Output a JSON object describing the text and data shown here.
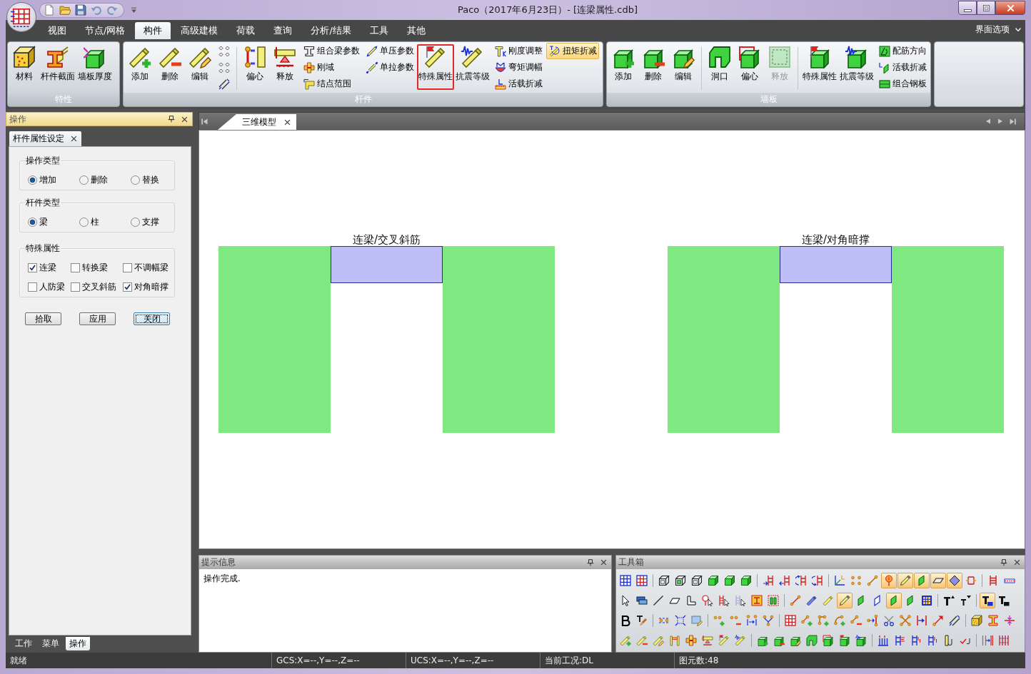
{
  "window": {
    "title": "Paco（2017年6月23日）- [连梁属性.cdb]"
  },
  "ribbon": {
    "tabs": [
      {
        "label": "视图",
        "selected": false
      },
      {
        "label": "节点/网格",
        "selected": false
      },
      {
        "label": "构件",
        "selected": true
      },
      {
        "label": "高级建模",
        "selected": false
      },
      {
        "label": "荷载",
        "selected": false
      },
      {
        "label": "查询",
        "selected": false
      },
      {
        "label": "分析/结果",
        "selected": false
      },
      {
        "label": "工具",
        "selected": false
      },
      {
        "label": "其他",
        "selected": false
      }
    ],
    "options_menu": "界面选项",
    "groups": [
      {
        "label": "特性",
        "items": [
          {
            "kind": "large",
            "label": "材料",
            "disabled": false,
            "highlighted": false
          },
          {
            "kind": "large",
            "label": "杆件截面",
            "disabled": false,
            "highlighted": false
          },
          {
            "kind": "large",
            "label": "墙板厚度",
            "disabled": false,
            "highlighted": false
          }
        ]
      },
      {
        "label": "杆件",
        "items": [
          {
            "kind": "large",
            "label": "添加",
            "disabled": false,
            "highlighted": false
          },
          {
            "kind": "large",
            "label": "删除",
            "disabled": false,
            "highlighted": false
          },
          {
            "kind": "large",
            "label": "编辑",
            "disabled": false,
            "highlighted": false
          },
          {
            "kind": "icons",
            "items": [
              {
                "on": false
              },
              {
                "on": false
              },
              {
                "on": false
              }
            ]
          },
          {
            "kind": "separator"
          },
          {
            "kind": "large",
            "label": "偏心",
            "disabled": false,
            "highlighted": false
          },
          {
            "kind": "large",
            "label": "释放",
            "disabled": false,
            "highlighted": false
          },
          {
            "kind": "stack",
            "items": [
              {
                "label": "组合梁参数",
                "on": false
              },
              {
                "label": "刚域",
                "on": false
              },
              {
                "label": "结点范围",
                "on": false
              }
            ]
          },
          {
            "kind": "stack",
            "items": [
              {
                "label": "单压参数",
                "on": false
              },
              {
                "label": "单拉参数",
                "on": false
              }
            ]
          },
          {
            "kind": "large",
            "label": "特殊属性",
            "disabled": false,
            "highlighted": true
          },
          {
            "kind": "large",
            "label": "抗震等级",
            "disabled": false,
            "highlighted": false
          },
          {
            "kind": "stack",
            "items": [
              {
                "label": "刚度调整",
                "on": false
              },
              {
                "label": "弯矩调幅",
                "on": false
              },
              {
                "label": "活载折减",
                "on": false
              }
            ]
          },
          {
            "kind": "stack",
            "items": [
              {
                "label": "扭矩折减",
                "on": true
              }
            ]
          }
        ]
      },
      {
        "label": "墙板",
        "items": [
          {
            "kind": "large",
            "label": "添加",
            "disabled": false,
            "highlighted": false
          },
          {
            "kind": "large",
            "label": "删除",
            "disabled": false,
            "highlighted": false
          },
          {
            "kind": "large",
            "label": "编辑",
            "disabled": false,
            "highlighted": false
          },
          {
            "kind": "separator"
          },
          {
            "kind": "large",
            "label": "洞口",
            "disabled": false,
            "highlighted": false
          },
          {
            "kind": "large",
            "label": "偏心",
            "disabled": false,
            "highlighted": false
          },
          {
            "kind": "large",
            "label": "释放",
            "disabled": true,
            "highlighted": false
          },
          {
            "kind": "separator"
          },
          {
            "kind": "large",
            "label": "特殊属性",
            "disabled": false,
            "highlighted": false
          },
          {
            "kind": "large",
            "label": "抗震等级",
            "disabled": false,
            "highlighted": false
          },
          {
            "kind": "stack",
            "items": [
              {
                "label": "配筋方向",
                "on": false
              },
              {
                "label": "活载折减",
                "on": false
              },
              {
                "label": "组合钢板",
                "on": false
              }
            ]
          }
        ]
      }
    ]
  },
  "operation_panel": {
    "title": "操作",
    "tabs": [
      {
        "label": "杆件属性设定",
        "selected": true
      }
    ],
    "sections": [
      {
        "title": "操作类型",
        "kind": "radio",
        "options": [
          {
            "label": "增加",
            "selected": true
          },
          {
            "label": "删除",
            "selected": false
          },
          {
            "label": "替换",
            "selected": false
          }
        ]
      },
      {
        "title": "杆件类型",
        "kind": "radio",
        "options": [
          {
            "label": "梁",
            "selected": true
          },
          {
            "label": "柱",
            "selected": false
          },
          {
            "label": "支撑",
            "selected": false
          }
        ]
      },
      {
        "title": "特殊属性",
        "kind": "checkbox",
        "options": [
          {
            "label": "连梁",
            "checked": true
          },
          {
            "label": "转换梁",
            "checked": false
          },
          {
            "label": "不调幅梁",
            "checked": false
          },
          {
            "label": "人防梁",
            "checked": false
          },
          {
            "label": "交叉斜筋",
            "checked": false
          },
          {
            "label": "对角暗撑",
            "checked": true
          }
        ]
      }
    ],
    "buttons": [
      {
        "label": "拾取",
        "focused": false
      },
      {
        "label": "应用",
        "focused": false
      },
      {
        "label": "关闭",
        "focused": true
      }
    ],
    "bottom_tabs": [
      {
        "label": "工作",
        "selected": false
      },
      {
        "label": "菜单",
        "selected": false
      },
      {
        "label": "操作",
        "selected": true
      }
    ]
  },
  "document": {
    "tabs": [
      {
        "label": "三维模型",
        "selected": true
      }
    ],
    "frames": [
      {
        "label": "连梁/交叉斜筋"
      },
      {
        "label": "连梁/对角暗撑"
      }
    ]
  },
  "hint_panel": {
    "title": "提示信息",
    "message": "操作完成."
  },
  "toolbox": {
    "title": "工具箱",
    "rows": [
      [
        [
          {
            "on": false
          },
          {
            "on": false
          }
        ],
        [
          {
            "on": false
          },
          {
            "on": false
          },
          {
            "on": false
          },
          {
            "on": false
          },
          {
            "on": false
          },
          {
            "on": false
          }
        ],
        [
          {
            "on": false
          },
          {
            "on": false
          },
          {
            "on": false
          },
          {
            "on": false
          }
        ],
        [
          {
            "on": false
          },
          {
            "on": false
          },
          {
            "on": false
          },
          {
            "on": true
          },
          {
            "on": true
          },
          {
            "on": true
          },
          {
            "on": true
          },
          {
            "on": true
          },
          {
            "on": false
          }
        ],
        [
          {
            "on": false
          },
          {
            "on": false
          }
        ]
      ],
      [
        [
          {
            "on": false
          },
          {
            "on": false
          },
          {
            "on": false
          },
          {
            "on": false
          },
          {
            "on": false
          },
          {
            "on": false
          },
          {
            "on": false
          },
          {
            "on": false
          },
          {
            "on": false
          },
          {
            "on": false
          }
        ],
        [
          {
            "on": false
          },
          {
            "on": false
          },
          {
            "on": false
          },
          {
            "on": true
          },
          {
            "on": false
          },
          {
            "on": false
          },
          {
            "on": true
          },
          {
            "on": false
          },
          {
            "on": false
          }
        ],
        [
          {
            "on": false
          },
          {
            "on": false
          }
        ],
        [
          {
            "on": true
          },
          {
            "on": false
          }
        ]
      ],
      [
        [
          {
            "on": false
          },
          {
            "on": false
          }
        ],
        [
          {
            "on": false
          },
          {
            "on": false
          },
          {
            "on": false
          }
        ],
        [
          {
            "on": false
          },
          {
            "on": false
          },
          {
            "on": false
          },
          {
            "on": false
          }
        ],
        [
          {
            "on": false
          },
          {
            "on": false
          },
          {
            "on": false
          },
          {
            "on": false
          },
          {
            "on": false
          },
          {
            "on": false
          },
          {
            "on": false
          },
          {
            "on": false
          },
          {
            "on": false
          },
          {
            "on": false
          },
          {
            "on": false
          }
        ],
        [
          {
            "on": false
          },
          {
            "on": false
          },
          {
            "on": false
          }
        ]
      ],
      [
        [
          {
            "on": false
          },
          {
            "on": false
          },
          {
            "on": false
          },
          {
            "on": false
          },
          {
            "on": false
          },
          {
            "on": false
          },
          {
            "on": false
          },
          {
            "on": false
          }
        ],
        [
          {
            "on": false
          },
          {
            "on": false
          },
          {
            "on": false
          },
          {
            "on": false
          },
          {
            "on": false
          },
          {
            "on": false
          },
          {
            "on": false
          }
        ],
        [
          {
            "on": false
          },
          {
            "on": false
          },
          {
            "on": false
          },
          {
            "on": false
          },
          {
            "on": false
          },
          {
            "on": false
          }
        ],
        [
          {
            "on": false
          },
          {
            "on": false
          }
        ]
      ]
    ]
  },
  "status_bar": [
    "就绪",
    "GCS:X=--,Y=--,Z=--",
    "UCS:X=--,Y=--,Z=--",
    "当前工况:DL",
    "图元数:48"
  ]
}
